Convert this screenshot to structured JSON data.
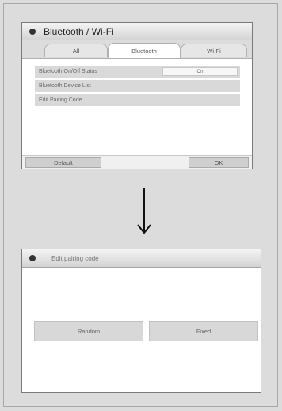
{
  "screen1": {
    "title": "Bluetooth / Wi-Fi",
    "tabs": [
      "All",
      "Bluetooth",
      "Wi-Fi"
    ],
    "menu": [
      {
        "label": "Bluetooth On/Off Status",
        "value": "On"
      },
      {
        "label": "Bluetooth Device List"
      },
      {
        "label": "Edit Pairing Code"
      }
    ],
    "buttons": {
      "default": "Default",
      "ok": "OK"
    }
  },
  "screen2": {
    "title": "Edit pairing code",
    "buttons": {
      "random": "Random",
      "fixed": "Fixed"
    }
  },
  "icons": {
    "title_bullet": "bullet-icon",
    "transition": "arrow-down-icon"
  }
}
